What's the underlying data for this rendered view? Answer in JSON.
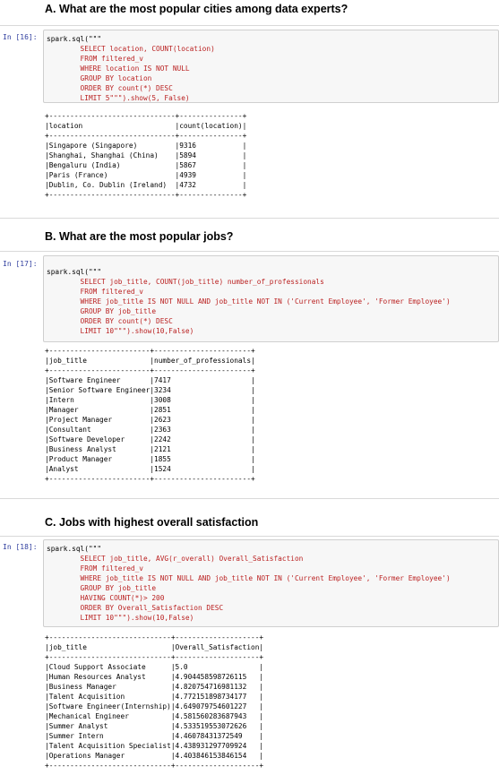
{
  "cells": [
    {
      "heading": "A. What are the most popular cities among data experts?",
      "prompt": "In [16]:",
      "code_lines": [
        "spark.sql(\"\"\"",
        "        SELECT location, COUNT(location)",
        "        FROM filtered_v",
        "        WHERE location IS NOT NULL",
        "        GROUP BY location",
        "        ORDER BY count(*) DESC",
        "        LIMIT 5\"\"\").show(5, False)"
      ],
      "output_lines": [
        "+------------------------------+---------------+",
        "|location                      |count(location)|",
        "+------------------------------+---------------+",
        "|Singapore (Singapore)         |9316           |",
        "|Shanghai, Shanghai (China)    |5894           |",
        "|Bengaluru (India)             |5867           |",
        "|Paris (France)                |4939           |",
        "|Dublin, Co. Dublin (Ireland)  |4732           |",
        "+------------------------------+---------------+"
      ]
    },
    {
      "heading": "B. What are the most popular jobs?",
      "prompt": "In [17]:",
      "code_lines": [
        "spark.sql(\"\"\"",
        "        SELECT job_title, COUNT(job_title) number_of_professionals",
        "        FROM filtered_v",
        "        WHERE job_title IS NOT NULL AND job_title NOT IN ('Current Employee', 'Former Employee')",
        "        GROUP BY job_title",
        "        ORDER BY count(*) DESC",
        "        LIMIT 10\"\"\").show(10,False)"
      ],
      "output_lines": [
        "+------------------------+-----------------------+",
        "|job_title               |number_of_professionals|",
        "+------------------------+-----------------------+",
        "|Software Engineer       |7417                   |",
        "|Senior Software Engineer|3234                   |",
        "|Intern                  |3008                   |",
        "|Manager                 |2851                   |",
        "|Project Manager         |2623                   |",
        "|Consultant              |2363                   |",
        "|Software Developer      |2242                   |",
        "|Business Analyst        |2121                   |",
        "|Product Manager         |1855                   |",
        "|Analyst                 |1524                   |",
        "+------------------------+-----------------------+"
      ]
    },
    {
      "heading": "C. Jobs with highest overall satisfaction",
      "prompt": "In [18]:",
      "code_lines": [
        "spark.sql(\"\"\"",
        "        SELECT job_title, AVG(r_overall) Overall_Satisfaction",
        "        FROM filtered_v",
        "        WHERE job_title IS NOT NULL AND job_title NOT IN ('Current Employee', 'Former Employee')",
        "        GROUP BY job_title",
        "        HAVING COUNT(*)> 200",
        "        ORDER BY Overall_Satisfaction DESC",
        "        LIMIT 10\"\"\").show(10,False)"
      ],
      "output_lines": [
        "+-----------------------------+--------------------+",
        "|job_title                    |Overall_Satisfaction|",
        "+-----------------------------+--------------------+",
        "|Cloud Support Associate      |5.0                 |",
        "|Human Resources Analyst      |4.904458598726115   |",
        "|Business Manager             |4.820754716981132   |",
        "|Talent Acquisition           |4.772151898734177   |",
        "|Software Engineer(Internship)|4.649079754601227   |",
        "|Mechanical Engineer          |4.581560283687943   |",
        "|Summer Analyst               |4.533519553072626   |",
        "|Summer Intern                |4.46078431372549    |",
        "|Talent Acquisition Specialist|4.438931297709924   |",
        "|Operations Manager           |4.403846153846154   |",
        "+-----------------------------+--------------------+"
      ]
    }
  ]
}
